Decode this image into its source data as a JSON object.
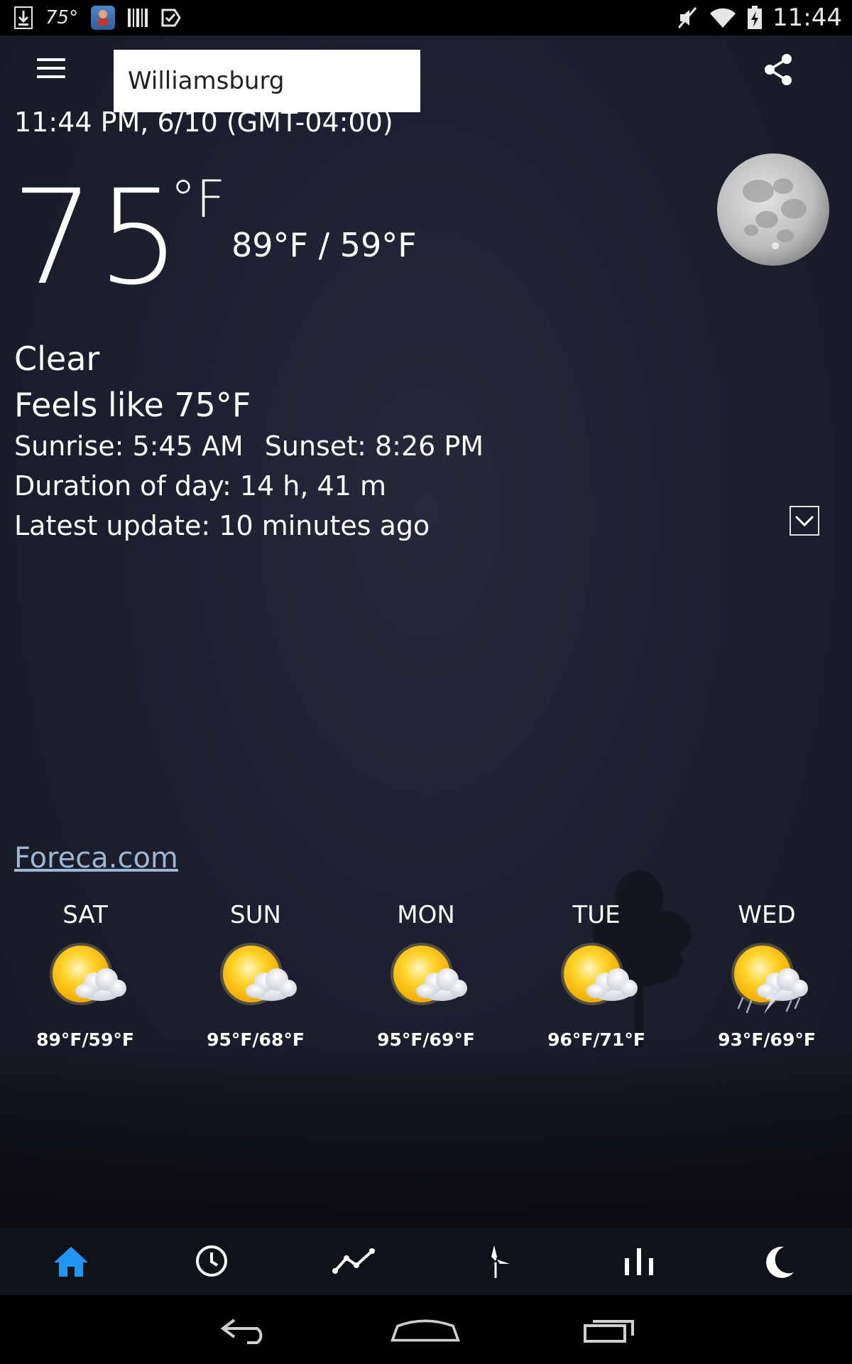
{
  "status_bar": {
    "temp": "75°",
    "time": "11:44"
  },
  "header": {
    "location": "Williamsburg",
    "datetime": "11:44 PM, 6/10 (GMT-04:00)"
  },
  "current": {
    "temperature": "75",
    "unit": "°F",
    "hilo": "89°F / 59°F",
    "condition": "Clear",
    "feels_like": "Feels like 75°F",
    "sunrise": "Sunrise: 5:45 AM",
    "sunset": "Sunset: 8:26 PM",
    "duration": "Duration of day: 14 h, 41 m",
    "latest_update": "Latest update: 10 minutes ago"
  },
  "source_link": "Foreca.com",
  "forecast": [
    {
      "day": "SAT",
      "range": "89°F/59°F",
      "icon": "partly-cloudy-icon"
    },
    {
      "day": "SUN",
      "range": "95°F/68°F",
      "icon": "partly-cloudy-icon"
    },
    {
      "day": "MON",
      "range": "95°F/69°F",
      "icon": "partly-cloudy-icon"
    },
    {
      "day": "TUE",
      "range": "96°F/71°F",
      "icon": "partly-cloudy-icon"
    },
    {
      "day": "WED",
      "range": "93°F/69°F",
      "icon": "thunderstorm-icon"
    }
  ],
  "tabs": [
    {
      "name": "home",
      "icon": "home-icon",
      "active": true
    },
    {
      "name": "hourly",
      "icon": "clock-icon",
      "active": false
    },
    {
      "name": "trend",
      "icon": "line-chart-icon",
      "active": false
    },
    {
      "name": "wind",
      "icon": "wind-turbine-icon",
      "active": false
    },
    {
      "name": "stats",
      "icon": "bar-chart-icon",
      "active": false
    },
    {
      "name": "night",
      "icon": "moon-icon",
      "active": false
    }
  ],
  "colors": {
    "active_tab": "#2196f3",
    "link": "#9fb6d3",
    "background": "#1b1e2a"
  }
}
